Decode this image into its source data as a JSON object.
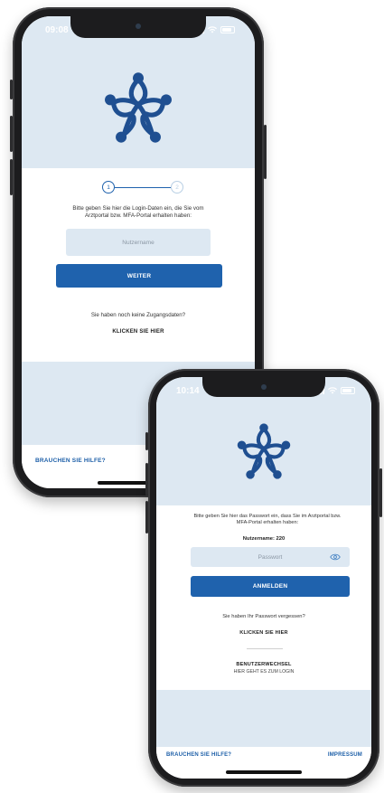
{
  "back_phone": {
    "status_time": "09:08",
    "steps": [
      "1",
      "2"
    ],
    "instruction": "Bitte geben Sie hier die Login-Daten ein, die Sie vom Arztportal bzw. MFA-Portal erhalten haben:",
    "username_placeholder": "Nutzername",
    "next_button": "WEITER",
    "no_access_text": "Sie haben noch keine Zugangsdaten?",
    "click_here": "KLICKEN SIE HIER",
    "help_link": "BRAUCHEN SIE HILFE?"
  },
  "front_phone": {
    "status_time": "10:14",
    "instruction": "Bitte geben Sie hier das Passwort ein, dass Sie im Arztportal bzw. MFA-Portal erhalten haben:",
    "username_label": "Nutzername: 220",
    "password_placeholder": "Passwort",
    "login_button": "ANMELDEN",
    "forgot_text": "Sie haben Ihr Passwort vergessen?",
    "click_here": "KLICKEN SIE HIER",
    "switch_user_title": "BENUTZERWECHSEL",
    "switch_user_sub": "HIER GEHT ES ZUM LOGIN",
    "help_link": "BRAUCHEN SIE HILFE?",
    "imprint_link": "IMPRESSUM"
  },
  "colors": {
    "primary": "#1f62ad",
    "light_blue": "#dde8f2",
    "phone_frame": "#1c1c1e"
  },
  "icons": [
    "app-logo-icon",
    "eye-icon",
    "signal-icon",
    "wifi-icon",
    "battery-icon"
  ]
}
